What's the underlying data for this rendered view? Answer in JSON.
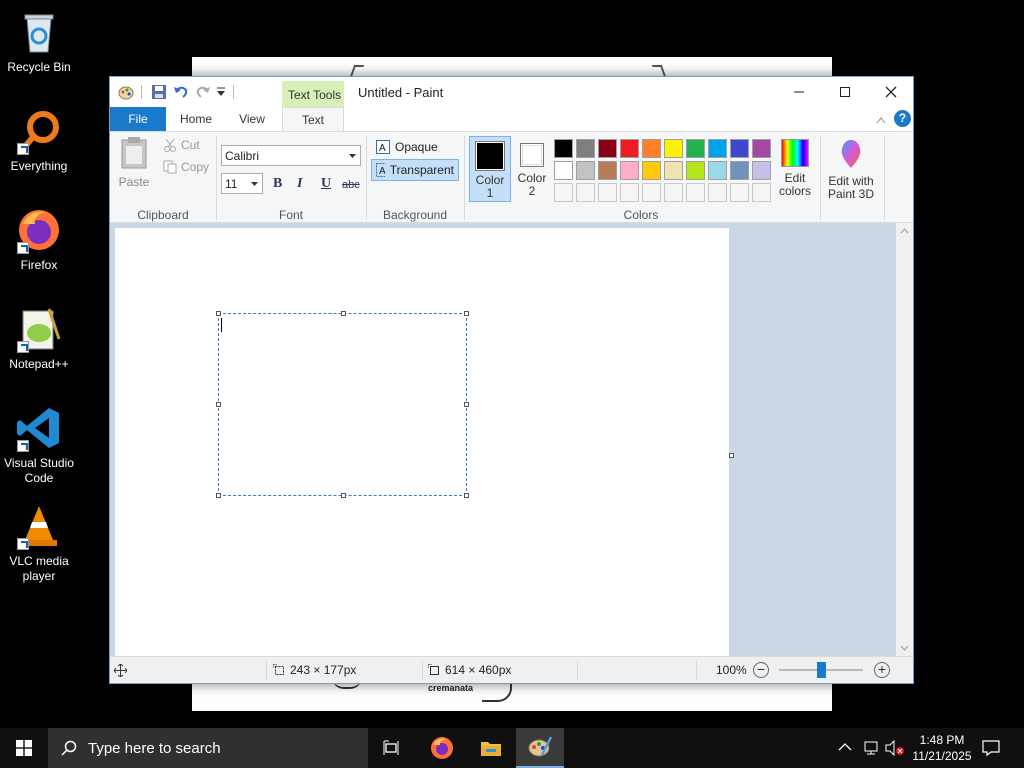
{
  "desktop": {
    "icons": [
      {
        "label": "Recycle Bin"
      },
      {
        "label": "Everything"
      },
      {
        "label": "Firefox"
      },
      {
        "label": "Notepad++"
      },
      {
        "label": "Visual Studio Code"
      },
      {
        "label": "VLC media player"
      }
    ]
  },
  "background_window": {
    "caption_text": "cremanata"
  },
  "paint": {
    "title": "Untitled - Paint",
    "context_tab": "Text Tools",
    "tabs": {
      "file": "File",
      "home": "Home",
      "view": "View",
      "text": "Text"
    },
    "clipboard": {
      "paste": "Paste",
      "cut": "Cut",
      "copy": "Copy",
      "group": "Clipboard"
    },
    "font": {
      "family": "Calibri",
      "size": "11",
      "bold": "B",
      "italic": "I",
      "underline": "U",
      "strike": "abc",
      "group": "Font"
    },
    "background": {
      "opaque": "Opaque",
      "transparent": "Transparent",
      "group": "Background"
    },
    "colors": {
      "color1_label_a": "Color",
      "color1_label_b": "1",
      "color2_label_a": "Color",
      "color2_label_b": "2",
      "color1": "#000000",
      "color2": "#ffffff",
      "edit_a": "Edit",
      "edit_b": "colors",
      "group": "Colors",
      "row1": [
        "#000000",
        "#7f7f7f",
        "#880015",
        "#ed1c24",
        "#ff7f27",
        "#fff200",
        "#22b14c",
        "#00a2e8",
        "#3f48cc",
        "#a349a4"
      ],
      "row2": [
        "#ffffff",
        "#c3c3c3",
        "#b97a57",
        "#ffaec9",
        "#ffc90e",
        "#efe4b0",
        "#b5e61d",
        "#99d9ea",
        "#7092be",
        "#c8bfe7"
      ]
    },
    "paint3d": {
      "a": "Edit with",
      "b": "Paint 3D"
    },
    "status": {
      "selection": "243 × 177px",
      "canvas_size": "614 × 460px",
      "zoom": "100%"
    }
  },
  "taskbar": {
    "search_placeholder": "Type here to search",
    "time": "1:48 PM",
    "date": "11/21/2025"
  }
}
